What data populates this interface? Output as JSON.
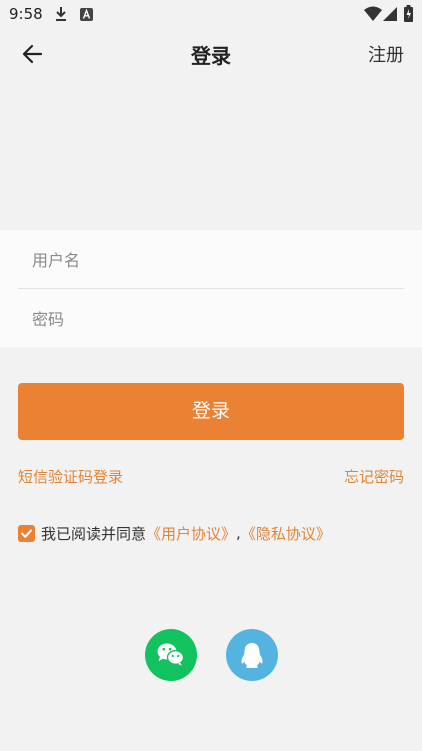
{
  "status_bar": {
    "time": "9:58",
    "icons": [
      "download-icon",
      "a-badge-icon",
      "wifi-icon",
      "signal-icon",
      "battery-icon"
    ]
  },
  "nav": {
    "title": "登录",
    "register_label": "注册",
    "back_icon": "arrow-left-icon"
  },
  "form": {
    "username": {
      "value": "",
      "placeholder": "用户名"
    },
    "password": {
      "value": "",
      "placeholder": "密码"
    }
  },
  "login_button_label": "登录",
  "links": {
    "sms_login": "短信验证码登录",
    "forgot_password": "忘记密码"
  },
  "agreement": {
    "checked": true,
    "text": "我已阅读并同意",
    "user_agreement": "《用户协议》",
    "separator": ",",
    "privacy_policy": "《隐私协议》"
  },
  "social_login": {
    "wechat_icon": "wechat-icon",
    "qq_icon": "qq-icon"
  },
  "colors": {
    "accent": "#ea8133",
    "link": "#e08535",
    "wechat": "#12c25f",
    "qq": "#55b3e0",
    "background": "#f2f2f2"
  }
}
